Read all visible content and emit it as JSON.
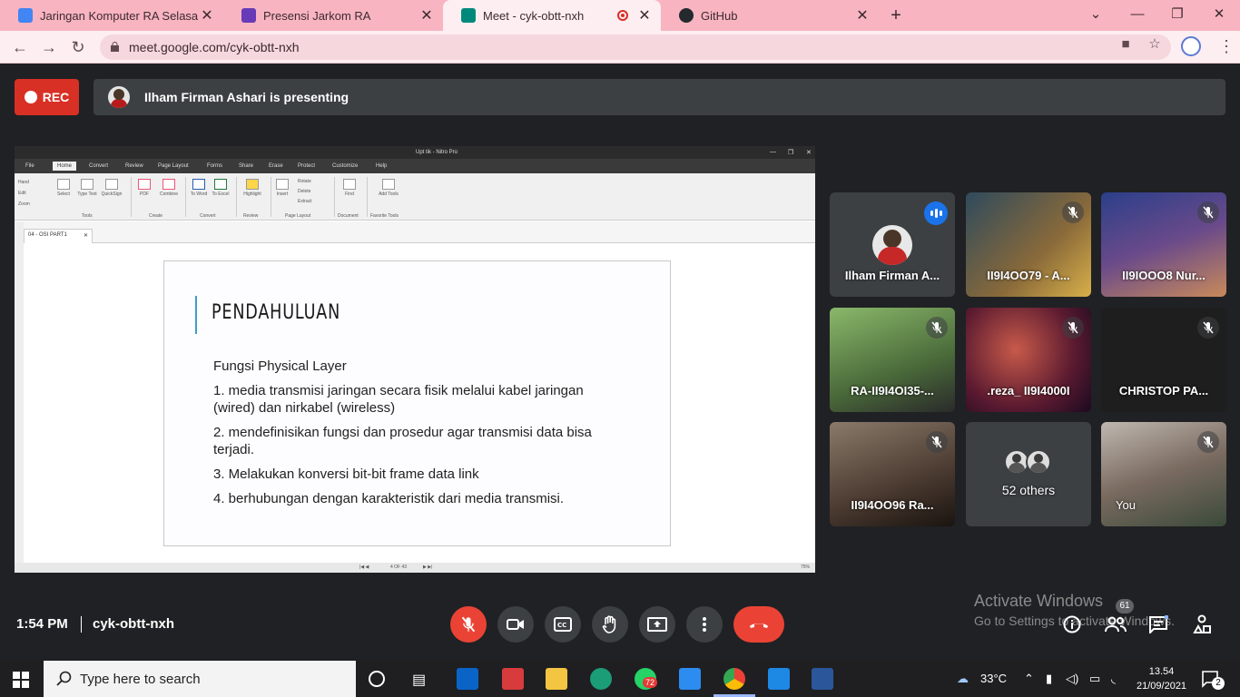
{
  "browser": {
    "tabs": [
      {
        "title": "Jaringan Komputer RA Selasa",
        "fav_color": "#4285f4"
      },
      {
        "title": "Presensi Jarkom RA",
        "fav_color": "#673ab7"
      },
      {
        "title": "Meet - cyk-obtt-nxh",
        "fav_color": "#00897b"
      },
      {
        "title": "GitHub",
        "fav_color": "#24292e"
      }
    ],
    "url": "meet.google.com/cyk-obtt-nxh"
  },
  "meet": {
    "rec_label": "REC",
    "presenting_label": "Ilham Firman Ashari is presenting",
    "time": "1:54 PM",
    "meeting_code": "cyk-obtt-nxh",
    "participant_badge": "61",
    "watermark_line1": "Activate Windows",
    "watermark_line2": "Go to Settings to activate Windows."
  },
  "screen": {
    "window_title": "Upt tik - Nitro Pro",
    "menu": [
      "File",
      "Home",
      "Convert",
      "Review",
      "Page Layout",
      "Forms",
      "Share",
      "Erase",
      "Protect",
      "Customize",
      "Help"
    ],
    "ribbon": {
      "tools": [
        "Hand",
        "Edit",
        "Zoom"
      ],
      "buttons": [
        "Select",
        "Type Text",
        "QuickSign",
        "PDF",
        "Combine",
        "To Word",
        "To Excel",
        "Highlight",
        "Insert",
        "Rotate",
        "Delete",
        "Extract",
        "Find",
        "Add Tools"
      ],
      "groups": [
        "Tools",
        "Create",
        "Convert",
        "Review",
        "Page Layout",
        "Document",
        "Favorite Tools"
      ]
    },
    "doc_tab": "04 - OSI PART1",
    "page_indicator": "4 OF 43",
    "zoom": "75%",
    "slide": {
      "heading": "PENDAHULUAN",
      "subheading": "Fungsi Physical Layer",
      "items": [
        "1. media transmisi jaringan secara fisik melalui kabel jaringan (wired) dan nirkabel (wireless)",
        "2. mendefinisikan fungsi dan prosedur agar transmisi data bisa terjadi.",
        "3. Melakukan konversi bit-bit frame data link",
        "4. berhubungan dengan karakteristik dari media transmisi."
      ]
    }
  },
  "participants": [
    {
      "name": "Ilham Firman A...",
      "bg": "#3c4043"
    },
    {
      "name": "II9I4OO79 - A...",
      "bg": "#2e4a5c"
    },
    {
      "name": "II9IOOO8 Nur...",
      "bg": "#2b3f8a"
    },
    {
      "name": "RA-II9I4OI35-...",
      "bg": "#5a7a4a"
    },
    {
      "name": ".reza_ II9I4000I",
      "bg": "#6a2a30"
    },
    {
      "name": "CHRISTOP PA...",
      "bg": "#1e1e1e"
    },
    {
      "name": "II9I4OO96 Ra...",
      "bg": "#4a3a30"
    },
    {
      "name": "52 others",
      "bg": "#3c4043"
    },
    {
      "name": "You",
      "bg": "#7a6a60"
    }
  ],
  "taskbar": {
    "search_placeholder": "Type here to search",
    "temperature": "33°C",
    "clock_time": "13.54",
    "clock_date": "21/09/2021",
    "notif_count": "2",
    "whatsapp_badge": "72"
  }
}
